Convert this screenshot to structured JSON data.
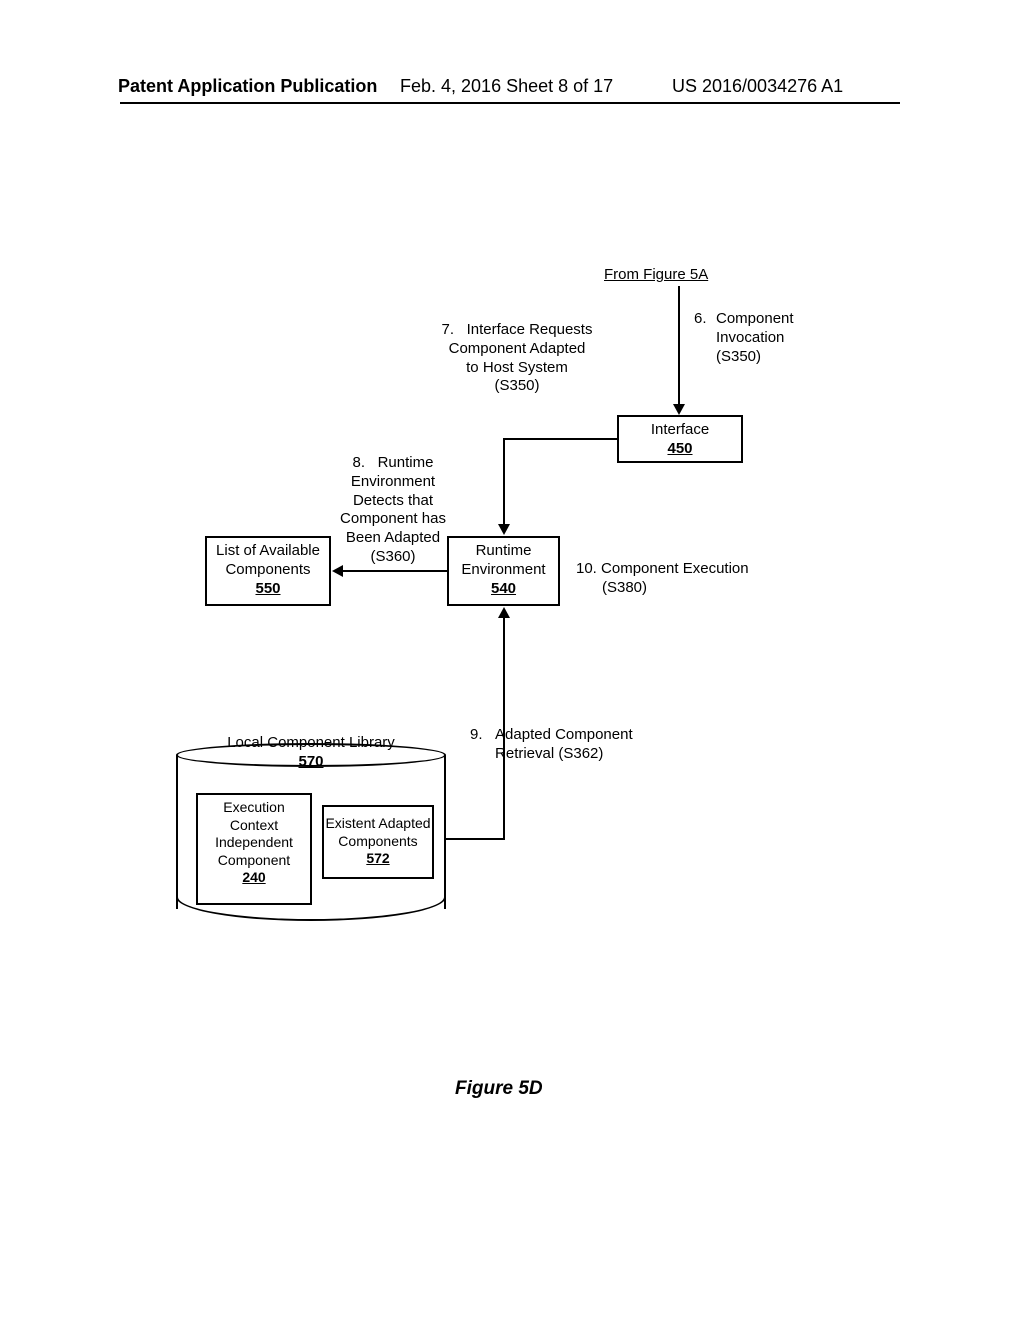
{
  "header": {
    "left": "Patent Application Publication",
    "mid": "Feb. 4, 2016  Sheet 8 of 17",
    "right": "US 2016/0034276 A1"
  },
  "fromFigure": "From Figure 5A",
  "labels": {
    "step6_num": "6.",
    "step6_a": "Component",
    "step6_b": "Invocation",
    "step6_c": "(S350)",
    "step7_num": "7.",
    "step7_a": "Interface Requests",
    "step7_b": "Component Adapted",
    "step7_c": "to Host System",
    "step7_d": "(S350)",
    "step8_num": "8.",
    "step8_a": "Runtime",
    "step8_b": "Environment",
    "step8_c": "Detects that",
    "step8_d": "Component has",
    "step8_e": "Been Adapted",
    "step8_f": "(S360)",
    "step9_num": "9.",
    "step9_a": "Adapted Component",
    "step9_b": "Retrieval (S362)",
    "step10": "10.  Component Execution",
    "step10b": "(S380)"
  },
  "boxes": {
    "interface_title": "Interface",
    "interface_ref": "450",
    "runtime_a": "Runtime",
    "runtime_b": "Environment",
    "runtime_ref": "540",
    "list_a": "List of Available",
    "list_b": "Components",
    "list_ref": "550",
    "lib_title": "Local Component Library",
    "lib_ref": "570",
    "ecic_a": "Execution",
    "ecic_b": "Context",
    "ecic_c": "Independent",
    "ecic_d": "Component",
    "ecic_ref": "240",
    "eac_a": "Existent Adapted",
    "eac_b": "Components",
    "eac_ref": "572"
  },
  "figure_caption": "Figure 5D"
}
